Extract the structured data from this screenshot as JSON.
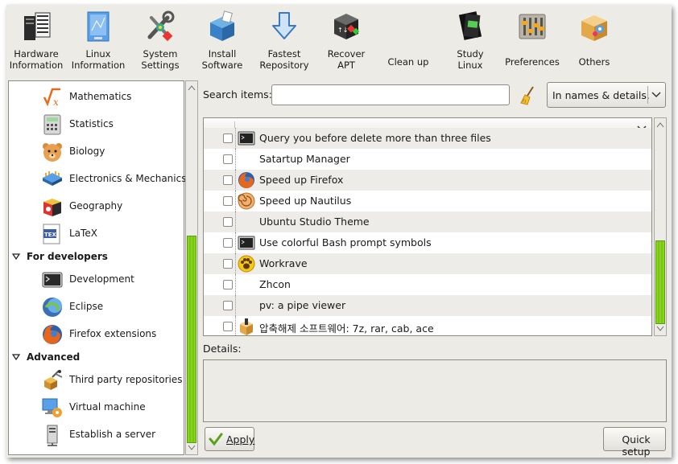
{
  "toolbar": {
    "items": [
      {
        "label": "Hardware\nInformation",
        "line1": "Hardware",
        "line2": "Information",
        "icon": "hardware-info-icon"
      },
      {
        "label": "Linux\nInformation",
        "line1": "Linux",
        "line2": "Information",
        "icon": "linux-info-icon"
      },
      {
        "label": "System\nSettings",
        "line1": "System",
        "line2": "Settings",
        "icon": "system-settings-icon"
      },
      {
        "label": "Install\nSoftware",
        "line1": "Install",
        "line2": "Software",
        "icon": "install-software-icon"
      },
      {
        "label": "Fastest\nRepository",
        "line1": "Fastest",
        "line2": "Repository",
        "icon": "fastest-repository-icon"
      },
      {
        "label": "Recover\nAPT",
        "line1": "Recover",
        "line2": "APT",
        "icon": "recover-apt-icon"
      },
      {
        "label": "Clean up",
        "line1": "Clean up",
        "line2": "",
        "icon": "clean-up-icon"
      },
      {
        "label": "Study\nLinux",
        "line1": "Study",
        "line2": "Linux",
        "icon": "study-linux-icon"
      },
      {
        "label": "Preferences",
        "line1": "Preferences",
        "line2": "",
        "icon": "preferences-icon"
      },
      {
        "label": "Others",
        "line1": "Others",
        "line2": "",
        "icon": "others-icon"
      }
    ]
  },
  "categories": {
    "items": [
      {
        "label": "Mathematics",
        "icon": "mathematics-icon"
      },
      {
        "label": "Statistics",
        "icon": "statistics-icon"
      },
      {
        "label": "Biology",
        "icon": "biology-icon"
      },
      {
        "label": "Electronics & Mechanics",
        "icon": "electronics-icon"
      },
      {
        "label": "Geography",
        "icon": "geography-icon"
      },
      {
        "label": "LaTeX",
        "icon": "latex-icon"
      }
    ],
    "developers_header": "For developers",
    "developers": [
      {
        "label": "Development",
        "icon": "terminal-icon"
      },
      {
        "label": "Eclipse",
        "icon": "eclipse-icon"
      },
      {
        "label": "Firefox extensions",
        "icon": "firefox-icon"
      }
    ],
    "advanced_header": "Advanced",
    "advanced": [
      {
        "label": "Third party repositories",
        "icon": "repositories-icon"
      },
      {
        "label": "Virtual machine",
        "icon": "virtual-machine-icon"
      },
      {
        "label": "Establish a server",
        "icon": "server-icon"
      }
    ]
  },
  "search": {
    "label": "Search items:",
    "value": "",
    "placeholder": "",
    "mode": "In names & details."
  },
  "items": [
    {
      "label": "Query you before delete more than three files",
      "icon": "terminal-icon",
      "checked": false
    },
    {
      "label": "Satartup Manager",
      "icon": "",
      "checked": false
    },
    {
      "label": "Speed up Firefox",
      "icon": "firefox-icon",
      "checked": false
    },
    {
      "label": "Speed up Nautilus",
      "icon": "nautilus-icon",
      "checked": false
    },
    {
      "label": "Ubuntu Studio Theme",
      "icon": "",
      "checked": false
    },
    {
      "label": "Use colorful Bash prompt symbols",
      "icon": "terminal-icon",
      "checked": false
    },
    {
      "label": "Workrave",
      "icon": "workrave-icon",
      "checked": false
    },
    {
      "label": "Zhcon",
      "icon": "",
      "checked": false
    },
    {
      "label": "pv: a pipe viewer",
      "icon": "",
      "checked": false
    },
    {
      "label": "압축해제 소프트웨어: 7z, rar, cab, ace",
      "icon": "archive-icon",
      "checked": false
    }
  ],
  "details": {
    "label": "Details:",
    "text": ""
  },
  "buttons": {
    "apply": "Apply",
    "quick_setup": "Quick setup"
  },
  "colors": {
    "accent_green": "#7ec91a",
    "window_bg": "#edebe6",
    "row_alt": "#edece9"
  }
}
